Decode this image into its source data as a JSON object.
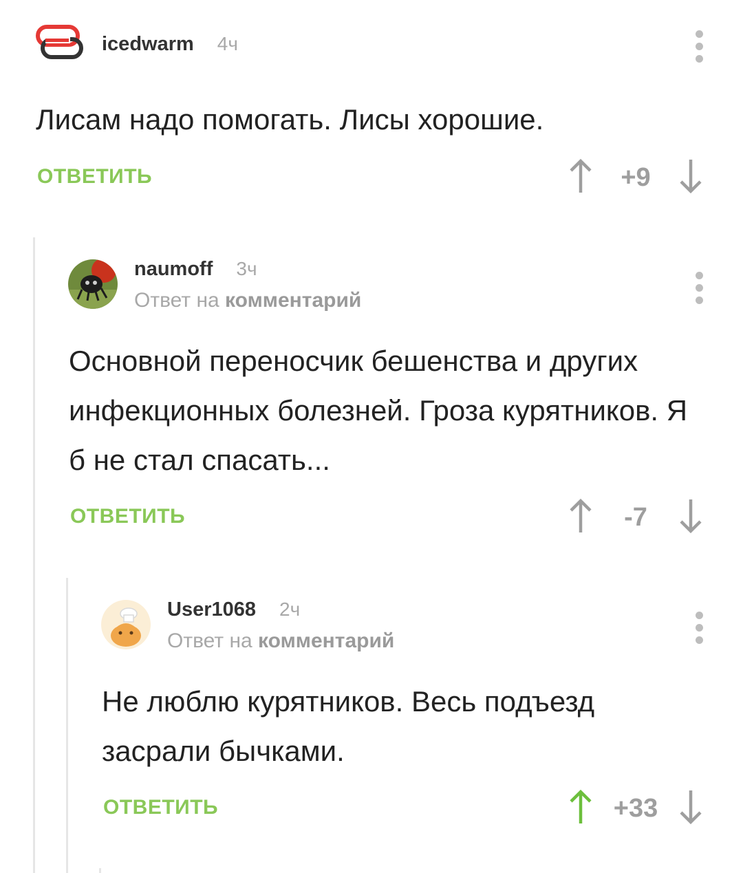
{
  "comments": [
    {
      "author": "icedwarm",
      "time": "4ч",
      "text": "Лисам надо помогать. Лисы хорошие.",
      "reply_label": "ОТВЕТИТЬ",
      "rating": "+9"
    },
    {
      "author": "naumoff",
      "time": "3ч",
      "reply_to_prefix": "Ответ на",
      "reply_to_link": "комментарий",
      "text": "Основной переносчик бешенства и других инфекционных болезней. Гроза курятников. Я б не стал спасать...",
      "reply_label": "ОТВЕТИТЬ",
      "rating": "-7"
    },
    {
      "author": "User1068",
      "time": "2ч",
      "reply_to_prefix": "Ответ на",
      "reply_to_link": "комментарий",
      "text": "Не люблю курятников. Весь подъезд засрали бычками.",
      "reply_label": "ОТВЕТИТЬ",
      "rating": "+33"
    }
  ],
  "colors": {
    "accent_green": "#8ac858",
    "upvoted_green": "#6cbf3c",
    "muted_gray": "#a8a8a8",
    "text": "#222222"
  },
  "icons": [
    "logo-icon",
    "more-vertical-icon",
    "arrow-up-icon",
    "arrow-down-icon",
    "avatar-image"
  ]
}
